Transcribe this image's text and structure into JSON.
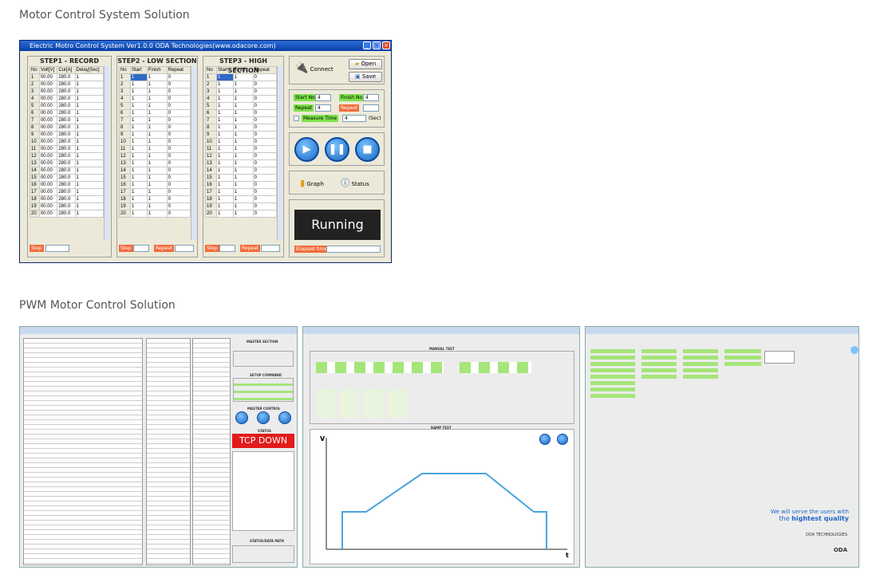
{
  "headings": {
    "motor": "Motor Control System Solution",
    "pwm": "PWM Motor Control Solution"
  },
  "window": {
    "title": "Electric Motro Control System Ver1.0.0 ODA Technologies(www.odacore.com)"
  },
  "step1": {
    "title": "STEP1 - RECORD",
    "cols": [
      "No",
      "Volt[V]",
      "Cur[A]",
      "Delay[Sec]"
    ],
    "volt": "00.00",
    "cur": "280.0",
    "delay": "1",
    "footer": "Step"
  },
  "step2": {
    "title": "STEP2 - LOW SECTION",
    "cols": [
      "No",
      "Start",
      "Finish",
      "Repeat"
    ],
    "start": "1",
    "finish": "1",
    "repeat": "0",
    "step": "Step",
    "rep": "Repeat"
  },
  "step3": {
    "title": "STEP3 - HIGH SECTION",
    "cols": [
      "No",
      "Start",
      "Finish",
      "Repeat"
    ],
    "start": "1",
    "finish": "1",
    "repeat": "0",
    "step": "Step",
    "rep": "Repeat"
  },
  "rows": [
    "1",
    "2",
    "3",
    "4",
    "5",
    "6",
    "7",
    "8",
    "9",
    "10",
    "11",
    "12",
    "13",
    "14",
    "15",
    "16",
    "17",
    "18",
    "19",
    "20"
  ],
  "controls": {
    "connect": "Connect",
    "open": "Open",
    "save": "Save",
    "start_no": "Start No",
    "start_no_val": "4",
    "finish_no": "Finish No",
    "finish_no_val": "4",
    "repeat": "Repeat",
    "repeat_val": "4",
    "measure": "Measure Time",
    "measure_val": "4",
    "sec": "(Sec)",
    "graph": "Graph",
    "status": "Status",
    "running": "Running",
    "elapsed": "Elapsed time"
  },
  "shot1": {
    "master": "MASTER SECTION",
    "setup": "SETUP COMMAND",
    "master_ctrl": "MASTER CONTROL",
    "status": "STATUS",
    "tcp": "TCP DOWN",
    "data": "STATUS/DATA PATH"
  },
  "shot2": {
    "manual": "MANUAL TEST",
    "ramp": "RAMP TEST",
    "v": "V",
    "t": "t"
  },
  "shot3": {
    "tag1": "We will serve the users with",
    "tag2": "the",
    "tag3": "hightest quality",
    "company": "ODA TECHNOLOGIES",
    "logo": "ODA"
  },
  "colors": {
    "accent": "#2a6cd6",
    "orange": "#f26a38",
    "green": "#7de24a",
    "running_bg": "#222",
    "running_fg": "#fff",
    "tcp_bg": "#e21b1b"
  }
}
